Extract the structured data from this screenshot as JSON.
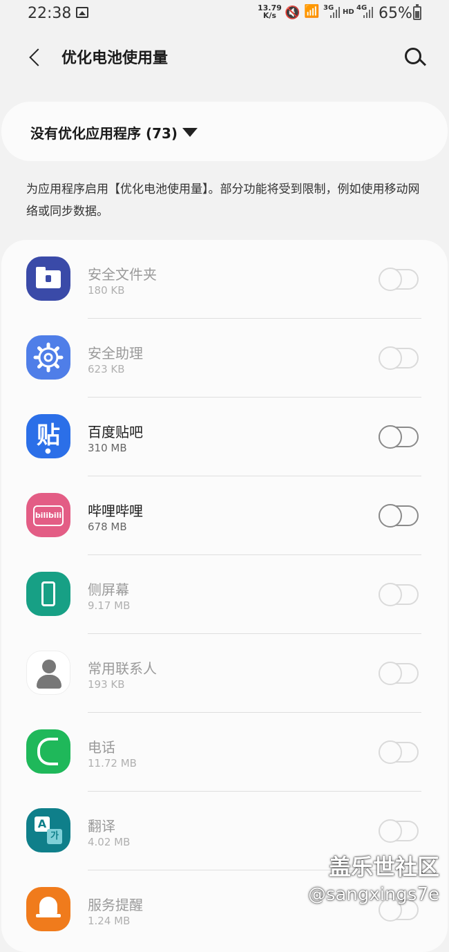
{
  "status_bar": {
    "time": "22:38",
    "net_speed_value": "13.79",
    "net_speed_unit": "K/s",
    "net_3g": "3G",
    "hd": "HD",
    "net_4g": "4G",
    "battery": "65%"
  },
  "header": {
    "title": "优化电池使用量"
  },
  "filter": {
    "label": "没有优化应用程序 (73)"
  },
  "description": "为应用程序启用【优化电池使用量】。部分功能将受到限制，例如使用移动网络或同步数据。",
  "apps": [
    {
      "name": "安全文件夹",
      "size": "180 KB",
      "enabled": false,
      "icon": "secure-folder-icon"
    },
    {
      "name": "安全助理",
      "size": "623 KB",
      "enabled": false,
      "icon": "gear-icon"
    },
    {
      "name": "百度贴吧",
      "size": "310 MB",
      "enabled": true,
      "icon": "tieba-icon",
      "icon_text": "贴"
    },
    {
      "name": "哔哩哔哩",
      "size": "678 MB",
      "enabled": true,
      "icon": "bilibili-icon",
      "icon_text": "bilibili"
    },
    {
      "name": "侧屏幕",
      "size": "9.17 MB",
      "enabled": false,
      "icon": "edge-screen-icon"
    },
    {
      "name": "常用联系人",
      "size": "193 KB",
      "enabled": false,
      "icon": "contact-icon"
    },
    {
      "name": "电话",
      "size": "11.72 MB",
      "enabled": false,
      "icon": "phone-icon"
    },
    {
      "name": "翻译",
      "size": "4.02 MB",
      "enabled": false,
      "icon": "translate-icon",
      "icon_text_a": "A",
      "icon_text_k": "가"
    },
    {
      "name": "服务提醒",
      "size": "1.24 MB",
      "enabled": false,
      "icon": "bell-icon"
    }
  ],
  "watermark": {
    "line1": "盖乐世社区",
    "line2": "@sangxings7e"
  },
  "colors": {
    "background": "#f2f2f2",
    "card": "#fbfbfb",
    "disabled_text": "#9a9a9a"
  }
}
